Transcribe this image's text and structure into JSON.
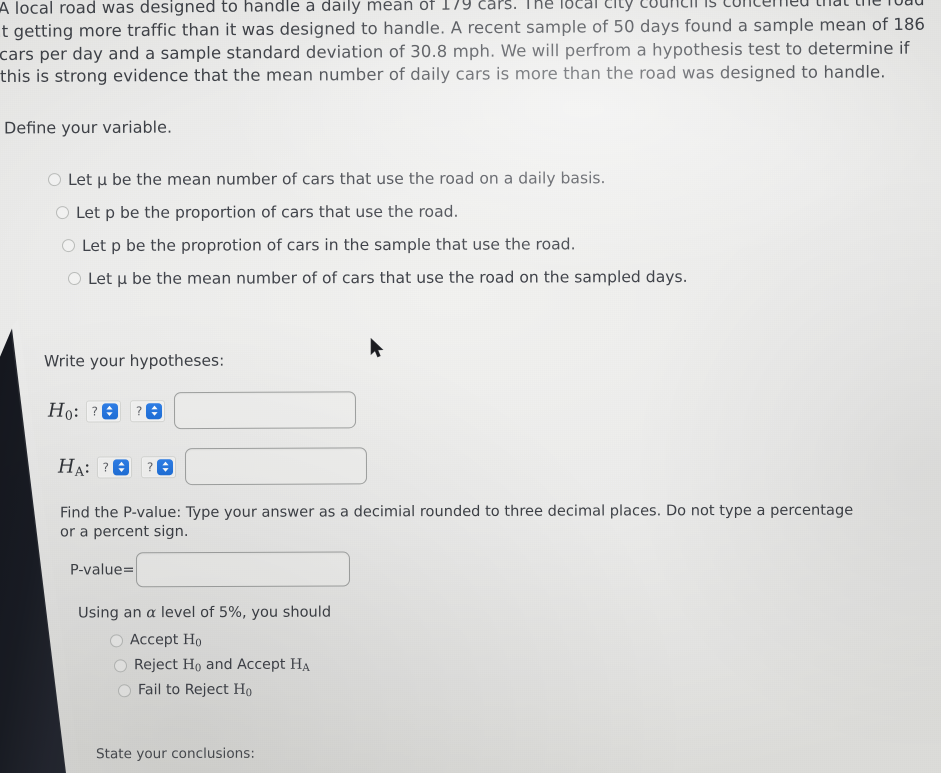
{
  "problem": {
    "lines": [
      "A local road was designed to handle a daily mean of 179 cars. The local city council is concerned that the road",
      "it getting more traffic than it was designed to handle. A recent sample of 50 days found a sample mean of 186",
      "cars per day and a sample standard deviation of 30.8 mph. We will perfrom a hypothesis test to determine if",
      "this is strong evidence that the mean number of daily cars is more than the road was designed to handle."
    ]
  },
  "define_variable": {
    "prompt": "Define your variable.",
    "options": [
      "Let μ be the mean number of cars that use the road on a daily basis.",
      "Let p be the proportion of cars that use the road.",
      "Let p be the proprotion of cars in the sample that use the road.",
      "Let μ be the mean number of of cars that use the road on the sampled days."
    ]
  },
  "hypotheses": {
    "prompt": "Write your hypotheses:",
    "null": {
      "name": "H",
      "subscript": "0",
      "colon": ":",
      "select_left": "?",
      "select_right": "?",
      "value": ""
    },
    "alt": {
      "name": "H",
      "subscript": "A",
      "colon": ":",
      "select_left": "?",
      "select_right": "?",
      "value": ""
    }
  },
  "pvalue": {
    "instructions": "Find the P-value: Type your answer as a decimial rounded to three decimal places. Do not type a percentage or a percent sign.",
    "label": "P-value=",
    "value": "",
    "placeholder": ""
  },
  "decision": {
    "prompt_prefix": "Using an ",
    "prompt_alpha": "α",
    "prompt_suffix": " level of 5%, you should",
    "options": [
      {
        "text_before": "Accept ",
        "sym": "H",
        "sub": "0",
        "text_mid": "",
        "sym2": "",
        "sub2": ""
      },
      {
        "text_before": "Reject ",
        "sym": "H",
        "sub": "0",
        "text_mid": " and Accept ",
        "sym2": "H",
        "sub2": "A"
      },
      {
        "text_before": "Fail to Reject ",
        "sym": "H",
        "sub": "0",
        "text_mid": "",
        "sym2": "",
        "sub2": ""
      }
    ]
  },
  "conclusions": {
    "prompt": "State your conclusions:"
  },
  "colors": {
    "page_background": "#ececeb",
    "text": "#3d4046",
    "stepper_blue": "#2076e0",
    "input_border": "#9fa1a0",
    "bezel_dark": "#191c24"
  },
  "icons": {
    "stepper": "up-down-arrows-icon",
    "cursor": "mouse-pointer-icon"
  }
}
